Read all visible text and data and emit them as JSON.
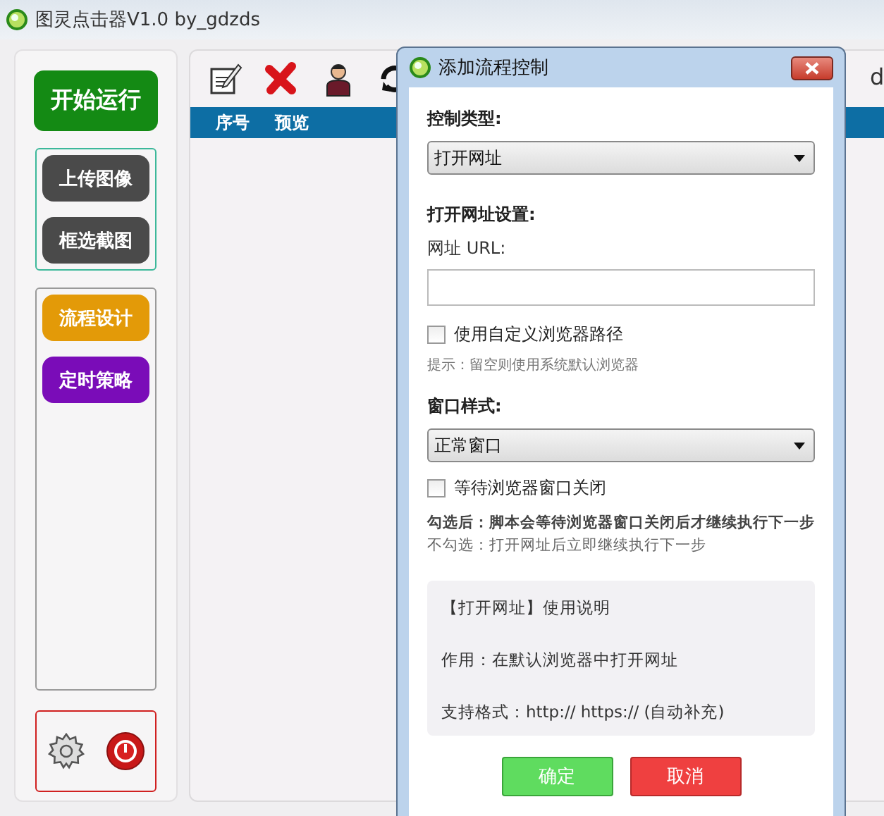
{
  "window": {
    "title": "图灵点击器V1.0 by_gdzds"
  },
  "sidebar": {
    "start_button": "开始运行",
    "groups": [
      {
        "kind": "images",
        "buttons": [
          {
            "label": "上传图像",
            "color": "#4a4a4a"
          },
          {
            "label": "框选截图",
            "color": "#4a4a4a"
          }
        ]
      },
      {
        "kind": "design",
        "buttons": [
          {
            "label": "流程设计",
            "color": "#e39a08"
          },
          {
            "label": "定时策略",
            "color": "#7a0cb8"
          }
        ]
      }
    ]
  },
  "main": {
    "toolbar_text": "d",
    "columns": [
      "序号",
      "预览"
    ]
  },
  "dialog": {
    "title": "添加流程控制",
    "type_label": "控制类型:",
    "type_value": "打开网址",
    "section_title": "打开网址设置:",
    "url_label": "网址 URL:",
    "custom_browser": {
      "label": "使用自定义浏览器路径",
      "checked": false
    },
    "hint": "提示：留空则使用系统默认浏览器",
    "window_style_label": "窗口样式:",
    "window_style_value": "正常窗口",
    "wait_close": {
      "label": "等待浏览器窗口关闭",
      "checked": false
    },
    "notes": [
      "勾选后：脚本会等待浏览器窗口关闭后才继续执行下一步",
      "不勾选：打开网址后立即继续执行下一步"
    ],
    "help": [
      "【打开网址】使用说明",
      "作用：在默认浏览器中打开网址",
      "支持格式：http:// https:// (自动补充)"
    ],
    "ok": "确定",
    "cancel": "取消"
  }
}
